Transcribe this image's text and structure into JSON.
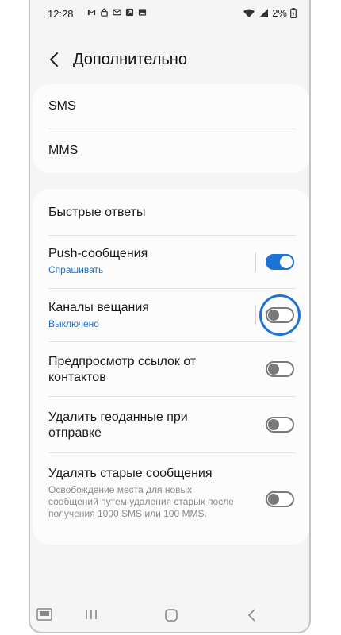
{
  "status_bar": {
    "time": "12:28",
    "battery": "2%",
    "icons": [
      "gmail-icon",
      "lock-icon",
      "mail-icon",
      "app-icon",
      "image-icon"
    ]
  },
  "header": {
    "title": "Дополнительно"
  },
  "group1": {
    "items": [
      {
        "label": "SMS"
      },
      {
        "label": "MMS"
      }
    ]
  },
  "group2": {
    "quick_replies": "Быстрые ответы",
    "push": {
      "label": "Push-сообщения",
      "sub": "Спрашивать",
      "on": true
    },
    "broadcast": {
      "label": "Каналы вещания",
      "sub": "Выключено",
      "on": false
    },
    "link_preview": {
      "label": "Предпросмотр ссылок от контактов",
      "on": false
    },
    "remove_geo": {
      "label": "Удалить геоданные при отправке",
      "on": false
    },
    "delete_old": {
      "label": "Удалять старые сообщения",
      "desc": "Освобождение места для новых сообщений путем удаления старых после получения 1000 SMS или 100 MMS.",
      "on": false
    }
  },
  "colors": {
    "accent": "#1e73d9",
    "subtext": "#1d6fcb"
  }
}
